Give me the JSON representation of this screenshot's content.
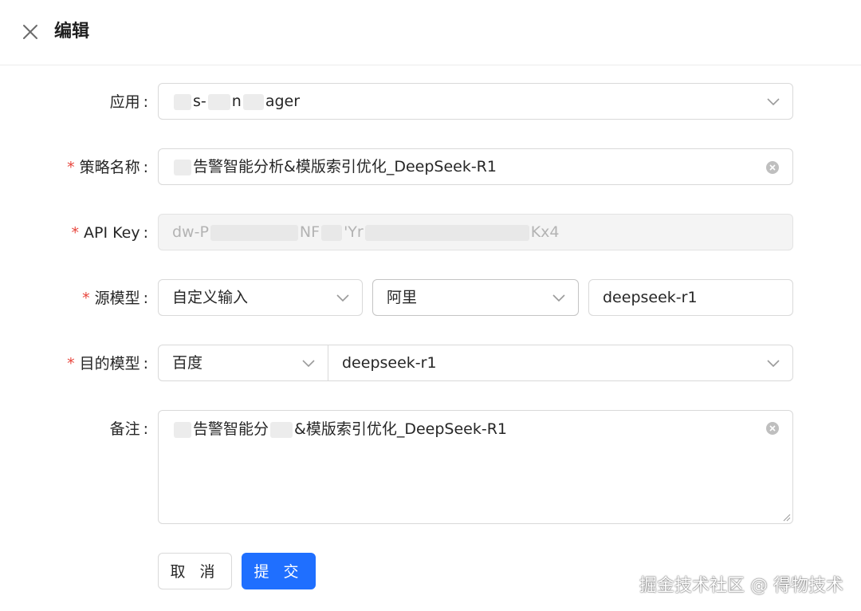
{
  "dialog": {
    "title": "编辑",
    "close_icon": "close-icon"
  },
  "form": {
    "app": {
      "label": "应用",
      "required": false,
      "value_parts": [
        "s-",
        "n",
        "ager"
      ],
      "icon": "chevron-down-icon"
    },
    "strategy_name": {
      "label": "策略名称",
      "required": true,
      "value": "告警智能分析&模版索引优化_DeepSeek-R1",
      "icon": "clear-icon"
    },
    "api_key": {
      "label": "API Key",
      "required": true,
      "value_parts": [
        "dw-P",
        "NF",
        "'Yr",
        "Kx4"
      ],
      "disabled": true
    },
    "source_model": {
      "label": "源模型",
      "required": true,
      "type_select": "自定义输入",
      "vendor_select": "阿里",
      "model_input": "deepseek-r1"
    },
    "target_model": {
      "label": "目的模型",
      "required": true,
      "vendor_select": "百度",
      "model_select": "deepseek-r1"
    },
    "remark": {
      "label": "备注",
      "required": false,
      "value_parts": [
        "告警智能分",
        "&模版索引优化_DeepSeek-R1"
      ],
      "icon": "clear-icon"
    }
  },
  "actions": {
    "cancel": "取 消",
    "submit": "提 交"
  },
  "colors": {
    "primary": "#1f6fff",
    "required_mark": "#e8453c",
    "border": "#d9d9d9"
  },
  "watermark": "掘金技术社区 @ 得物技术"
}
